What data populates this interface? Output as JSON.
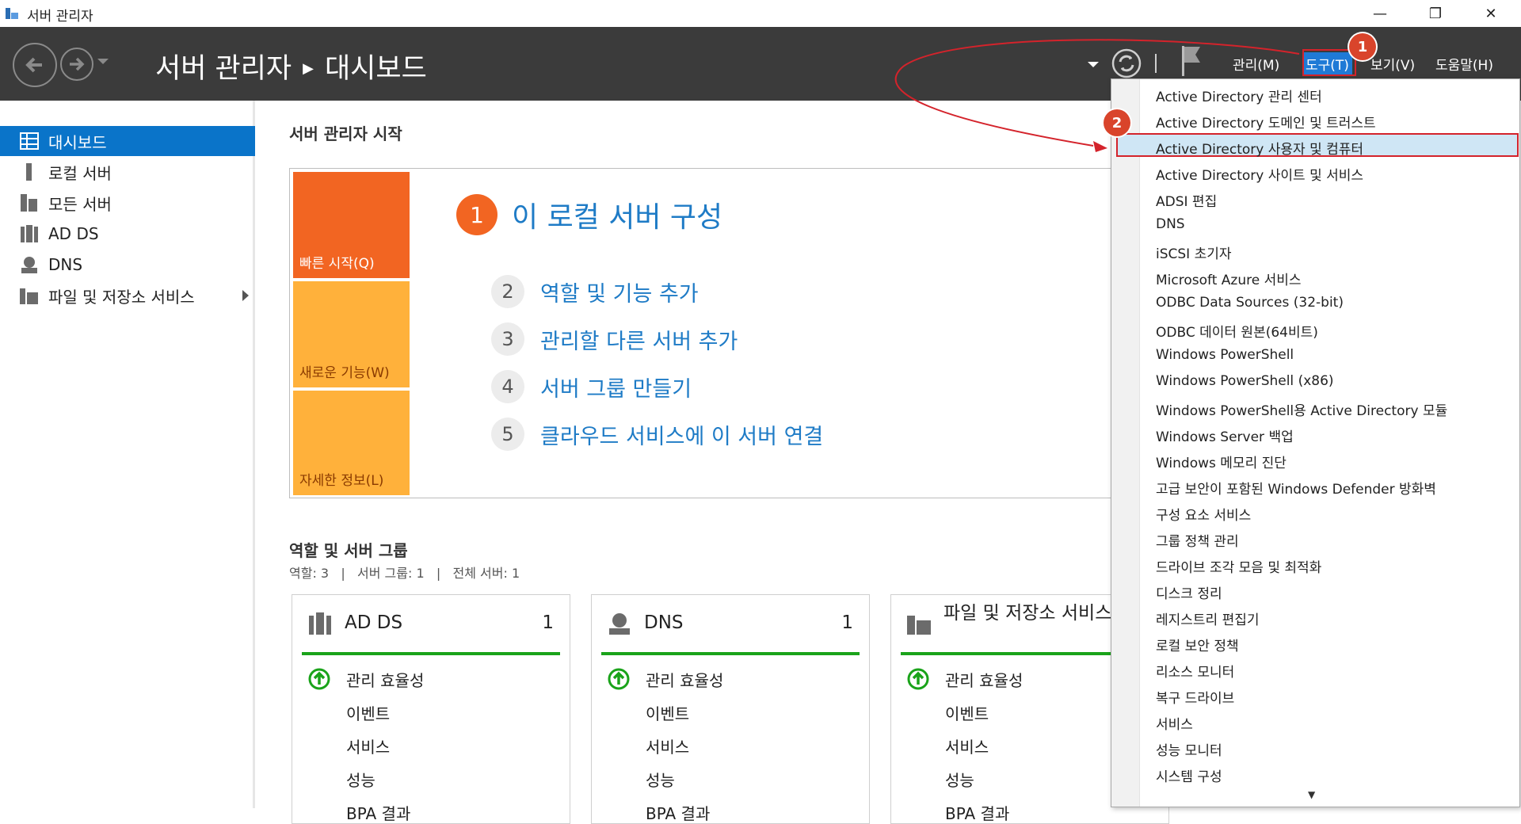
{
  "window": {
    "title": "서버 관리자",
    "minimize": "—",
    "maximize": "❐",
    "close": "✕"
  },
  "header": {
    "breadcrumb_root": "서버 관리자",
    "breadcrumb_sep": "▶",
    "breadcrumb_current": "대시보드",
    "menus": [
      "관리(M)",
      "도구(T)",
      "보기(V)",
      "도움말(H)"
    ]
  },
  "sidebar": {
    "items": [
      {
        "label": "대시보드"
      },
      {
        "label": "로컬 서버"
      },
      {
        "label": "모든 서버"
      },
      {
        "label": "AD DS"
      },
      {
        "label": "DNS"
      },
      {
        "label": "파일 및 저장소 서비스"
      }
    ]
  },
  "welcome": {
    "title": "서버 관리자 시작",
    "tiles": [
      "빠른 시작(Q)",
      "새로운 기능(W)",
      "자세한 정보(L)"
    ],
    "steps": [
      {
        "num": "1",
        "label": "이 로컬 서버 구성"
      },
      {
        "num": "2",
        "label": "역할 및 기능 추가"
      },
      {
        "num": "3",
        "label": "관리할 다른 서버 추가"
      },
      {
        "num": "4",
        "label": "서버 그룹 만들기"
      },
      {
        "num": "5",
        "label": "클라우드 서비스에 이 서버 연결"
      }
    ]
  },
  "roles": {
    "title": "역할 및 서버 그룹",
    "summary": "역할: 3   |   서버 그룹: 1   |   전체 서버: 1",
    "cards": [
      {
        "name": "AD DS",
        "count": "1",
        "rows": [
          "관리 효율성",
          "이벤트",
          "서비스",
          "성능",
          "BPA 결과"
        ]
      },
      {
        "name": "DNS",
        "count": "1",
        "rows": [
          "관리 효율성",
          "이벤트",
          "서비스",
          "성능",
          "BPA 결과"
        ]
      },
      {
        "name": "파일 및 저장소 서비스",
        "count": "",
        "rows": [
          "관리 효율성",
          "이벤트",
          "서비스",
          "성능",
          "BPA 결과"
        ]
      }
    ]
  },
  "tools_menu": {
    "items": [
      "Active Directory 관리 센터",
      "Active Directory 도메인 및 트러스트",
      "Active Directory 사용자 및 컴퓨터",
      "Active Directory 사이트 및 서비스",
      "ADSI 편집",
      "DNS",
      "iSCSI 초기자",
      "Microsoft Azure 서비스",
      "ODBC Data Sources (32-bit)",
      "ODBC 데이터 원본(64비트)",
      "Windows PowerShell",
      "Windows PowerShell (x86)",
      "Windows PowerShell용 Active Directory 모듈",
      "Windows Server 백업",
      "Windows 메모리 진단",
      "고급 보안이 포함된 Windows Defender 방화벽",
      "구성 요소 서비스",
      "그룹 정책 관리",
      "드라이브 조각 모음 및 최적화",
      "디스크 정리",
      "레지스트리 편집기",
      "로컬 보안 정책",
      "리소스 모니터",
      "복구 드라이브",
      "서비스",
      "성능 모니터",
      "시스템 구성"
    ],
    "highlighted_index": 2,
    "scroll_down": "▼"
  },
  "annotations": {
    "badge1": "1",
    "badge2": "2"
  },
  "colors": {
    "header_bg": "#3b3b3b",
    "accent": "#0a74c9",
    "orange": "#f26522",
    "light_orange": "#ffb13b",
    "link": "#1e7bc6",
    "highlight_border": "#d4232b"
  }
}
